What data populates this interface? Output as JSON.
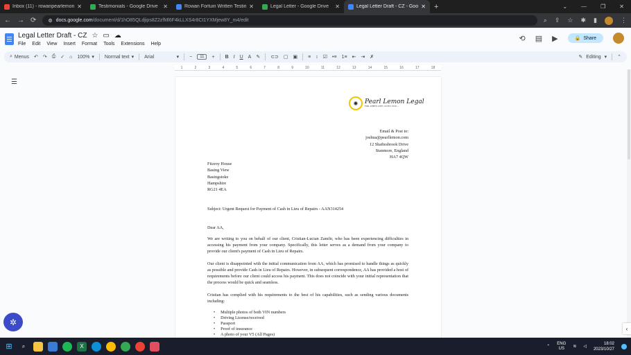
{
  "browser": {
    "tabs": [
      {
        "title": "Inbox (11) - rowanpearlemon@",
        "color": "#ea4335"
      },
      {
        "title": "Testimonials - Google Drive",
        "color": "#34a853"
      },
      {
        "title": "Rowan Fortuin Written Testimon",
        "color": "#4285f4"
      },
      {
        "title": "Legal Letter - Google Drive",
        "color": "#34a853"
      },
      {
        "title": "Legal Letter Draft - CZ - Google",
        "color": "#4285f4"
      }
    ],
    "url_domain": "docs.google.com",
    "url_path": "/document/d/1hO85QLdjips8Z2zfMl6F4kLLXS4r8Ct1YXMjew8Y_m4/edit"
  },
  "doc": {
    "title": "Legal Letter Draft - CZ",
    "menus": [
      "File",
      "Edit",
      "View",
      "Insert",
      "Format",
      "Tools",
      "Extensions",
      "Help"
    ],
    "share_label": "Share"
  },
  "toolbar": {
    "menus_label": "Menus",
    "zoom": "100%",
    "style": "Normal text",
    "font": "Arial",
    "size": "11",
    "mode": "Editing"
  },
  "ruler": [
    "1",
    "2",
    "3",
    "4",
    "5",
    "6",
    "7",
    "8",
    "9",
    "10",
    "11",
    "12",
    "13",
    "14",
    "15",
    "16",
    "17",
    "18"
  ],
  "letter": {
    "logo_name": "Pearl Lemon Legal",
    "logo_tagline": "FOR WHEN LIFE GIVES YOU...",
    "sender": [
      "Email & Post to:",
      "joshua@pearllemon.com",
      "12 Shaftesbrook Drive",
      "Stanmore, England",
      "HA7 4QW"
    ],
    "recipient": [
      "Fitzroy House",
      "Basing View",
      "Basingstoke",
      "Hampshire",
      "RG21 4EA"
    ],
    "subject": "Subject: Urgent Request for Payment of Cash in Lieu of Repairs - AAN314254",
    "greeting": "Dear AA,",
    "p1": "We are writing to you on behalf of our client, Cristian-Lucian Zamfir, who has been experiencing difficulties in accessing his payment from your company. Specifically, this letter serves as a demand from your company to provide our client's payment of Cash in Lieu of Repairs.",
    "p2": "Our client is disappointed with the initial communication from AA, which has promised to handle things as quickly as possible and provide Cash in Lieu of Repairs. However, in subsequent correspondence, AA has provided a host of requirements before our client could access his payment. This does not coincide with your initial representation that the process would be quick and seamless.",
    "p3": "Cristian has complied with his requirements to the best of his capabilities, such as sending various documents including:",
    "documents": [
      "Multiple photos of both VIN numbers",
      "Driving License/received",
      "Passport",
      "Proof of insurance",
      "A photo of your V5 (All Pages)"
    ]
  },
  "taskbar": {
    "lang": "ENG",
    "region": "US",
    "time": "18:02",
    "date": "2023/10/27"
  }
}
